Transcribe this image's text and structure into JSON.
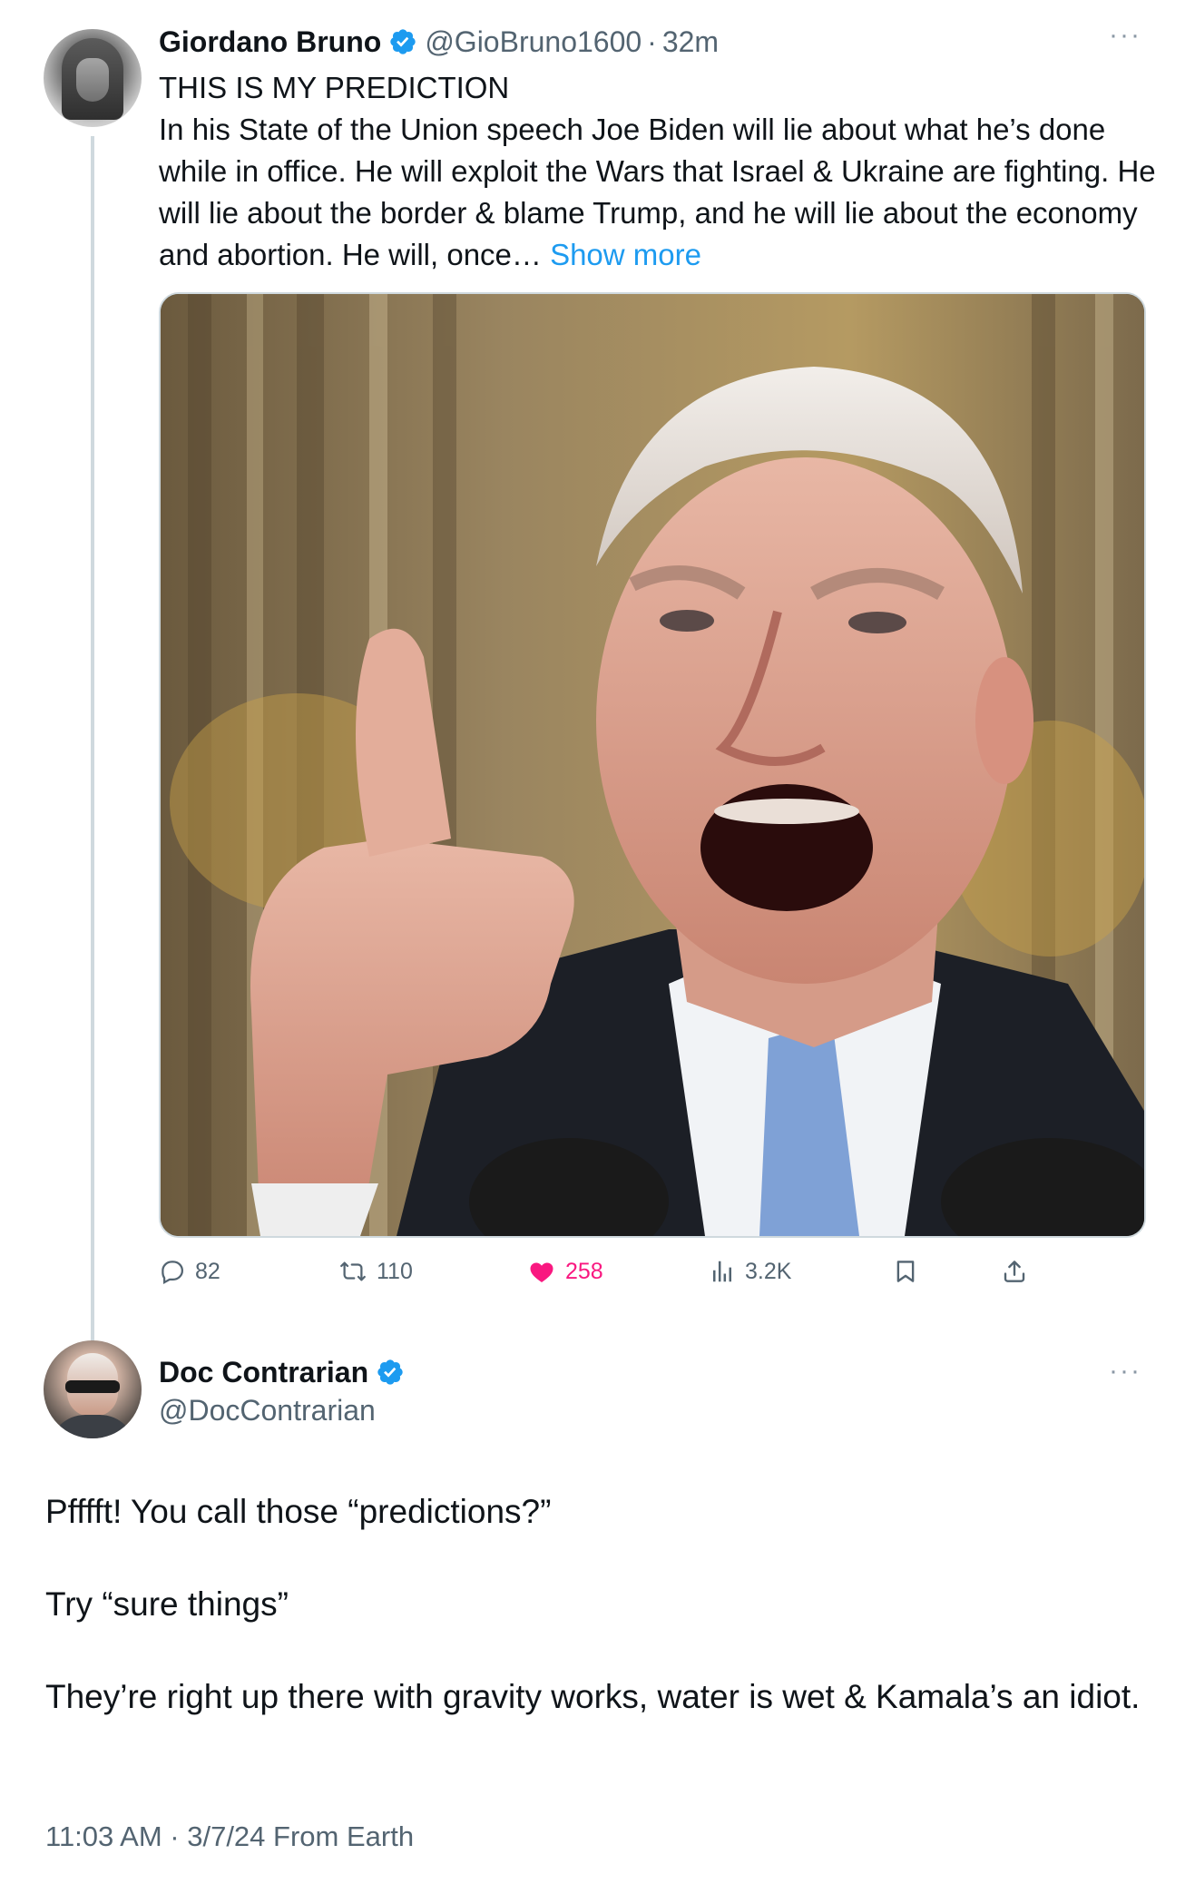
{
  "tweet": {
    "author": {
      "display_name": "Giordano Bruno",
      "handle": "@GioBruno1600",
      "verified": true
    },
    "time_ago": "32m",
    "separator": "·",
    "text_line1": "THIS IS MY PREDICTION",
    "text_body": "In his State of the Union speech Joe Biden will lie about what he’s done while in office. He will exploit the Wars that Israel & Ukraine are fighting. He will lie about the border & blame Trump, and he will lie about the economy and abortion. He will, once… ",
    "show_more": "Show more",
    "stats": {
      "replies": "82",
      "reposts": "110",
      "likes": "258",
      "views": "3.2K"
    },
    "liked": true
  },
  "reply": {
    "author": {
      "display_name": "Doc Contrarian",
      "handle": "@DocContrarian",
      "verified": true
    },
    "paragraphs": [
      "Pfffft! You call those “predictions?”",
      "Try “sure things”",
      "They’re right up there with gravity works, water is wet & Kamala’s an idiot."
    ],
    "timestamp": "11:03 AM · 3/7/24 From Earth"
  },
  "more_menu_glyph": "···",
  "colors": {
    "accent_blue": "#1d9bf0",
    "like_pink": "#f91880",
    "secondary_text": "#536471",
    "primary_text": "#0f1419",
    "thread_line": "#cfd9de"
  },
  "icons": [
    "reply-icon",
    "repost-icon",
    "like-icon",
    "views-icon",
    "bookmark-icon",
    "share-icon",
    "verified-badge-icon",
    "more-icon"
  ]
}
